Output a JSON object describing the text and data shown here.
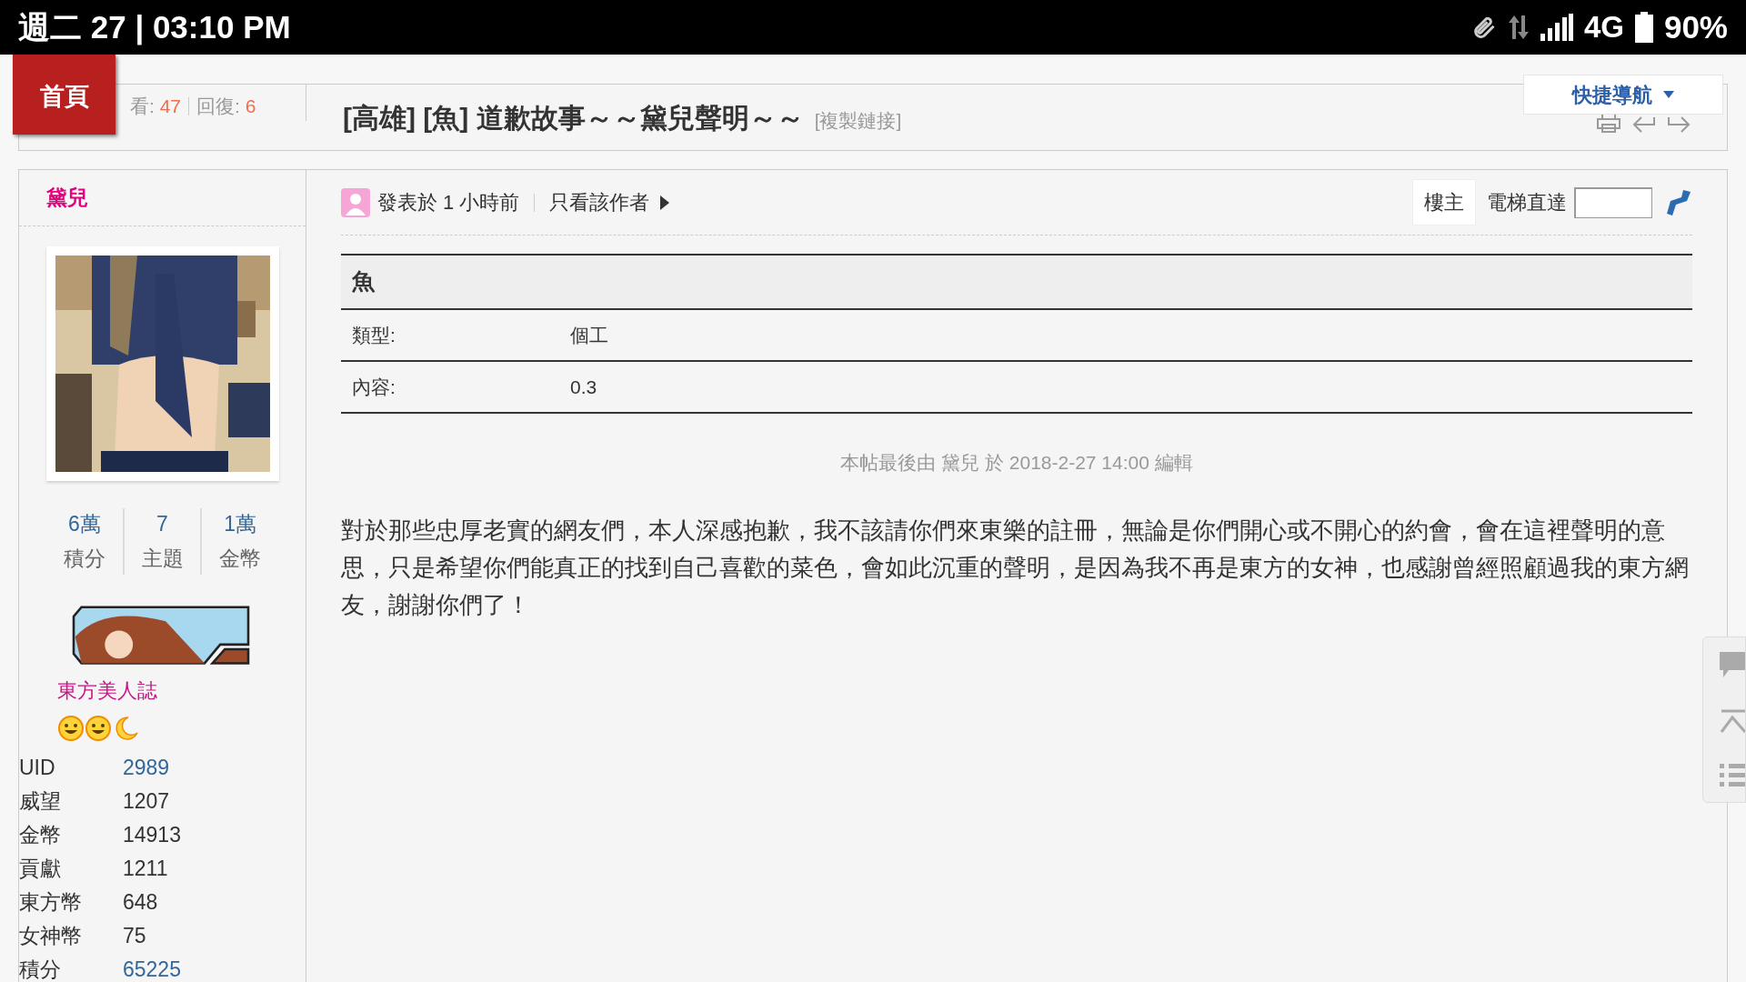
{
  "status_bar": {
    "time": "週二 27 | 03:10 PM",
    "network": "4G",
    "battery": "90%"
  },
  "nav": {
    "home": "首頁",
    "quick_nav": "快捷導航"
  },
  "thread": {
    "views_label": "看:",
    "views": "47",
    "replies_label": "回復:",
    "replies": "6",
    "title": "[高雄] [魚] 道歉故事～～黛兒聲明～～",
    "copy_link": "[複製鏈接]"
  },
  "author": {
    "name": "黛兒",
    "stats": [
      {
        "value": "6萬",
        "label": "積分"
      },
      {
        "value": "7",
        "label": "主題"
      },
      {
        "value": "1萬",
        "label": "金幣"
      }
    ],
    "group": "東方美人誌",
    "badges": [
      {
        "kind": "smile"
      },
      {
        "kind": "smile"
      },
      {
        "kind": "moon"
      }
    ],
    "profile": [
      {
        "label": "UID",
        "value": "2989",
        "link": true
      },
      {
        "label": "威望",
        "value": "1207",
        "link": false
      },
      {
        "label": "金幣",
        "value": "14913",
        "link": false
      },
      {
        "label": "貢獻",
        "value": "1211",
        "link": false
      },
      {
        "label": "東方幣",
        "value": "648",
        "link": false
      },
      {
        "label": "女神幣",
        "value": "75",
        "link": false
      },
      {
        "label": "積分",
        "value": "65225",
        "link": true
      }
    ]
  },
  "post": {
    "posted": "發表於 1 小時前",
    "only_author": "只看該作者",
    "floor": "樓主",
    "elevator": "電梯直達",
    "table": {
      "heading": "魚",
      "rows": [
        {
          "label": "類型:",
          "value": "個工"
        },
        {
          "label": "內容:",
          "value": "0.3"
        }
      ]
    },
    "edit_note": "本帖最後由 黛兒 於 2018-2-27 14:00 編輯",
    "body": "對於那些忠厚老實的網友們，本人深感抱歉，我不該請你們來東樂的註冊，無論是你們開心或不開心的約會，會在這裡聲明的意思，只是希望你們能真正的找到自己喜歡的菜色，會如此沉重的聲明，是因為我不再是東方的女神，也感謝曾經照顧過我的東方網友，謝謝你們了！"
  }
}
